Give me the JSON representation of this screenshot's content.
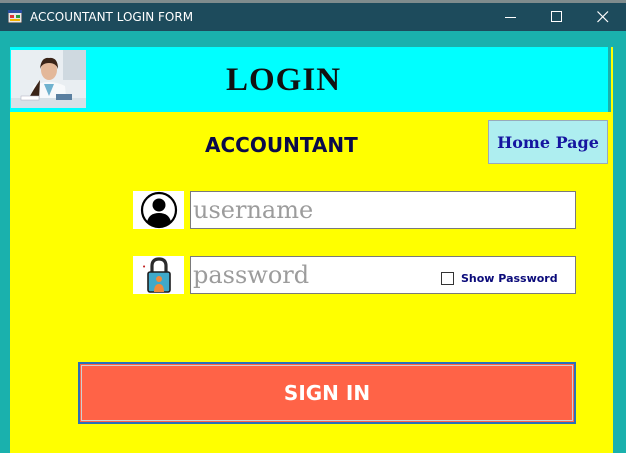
{
  "window": {
    "title": "ACCOUNTANT LOGIN FORM",
    "icon": "app-form-icon",
    "controls": [
      "minimize-icon",
      "maximize-icon",
      "close-icon"
    ]
  },
  "header": {
    "title": "LOGIN",
    "photo": "accountant-photo"
  },
  "role_title": "ACCOUNTANT",
  "home_button": {
    "label": "Home Page"
  },
  "username": {
    "value": "",
    "placeholder": "username",
    "icon": "user-icon"
  },
  "password": {
    "value": "",
    "placeholder": "password",
    "icon": "lock-icon"
  },
  "show_password": {
    "label": "Show Password",
    "checked": false
  },
  "signin_button": {
    "label": "SIGN IN"
  },
  "colors": {
    "titlebar": "#1d4b5c",
    "window_bg": "#1ab1ad",
    "header_band": "#00ffff",
    "form_bg": "#ffff00",
    "home_button_bg": "#aeeef0",
    "signin_bg": "#ff6347"
  }
}
